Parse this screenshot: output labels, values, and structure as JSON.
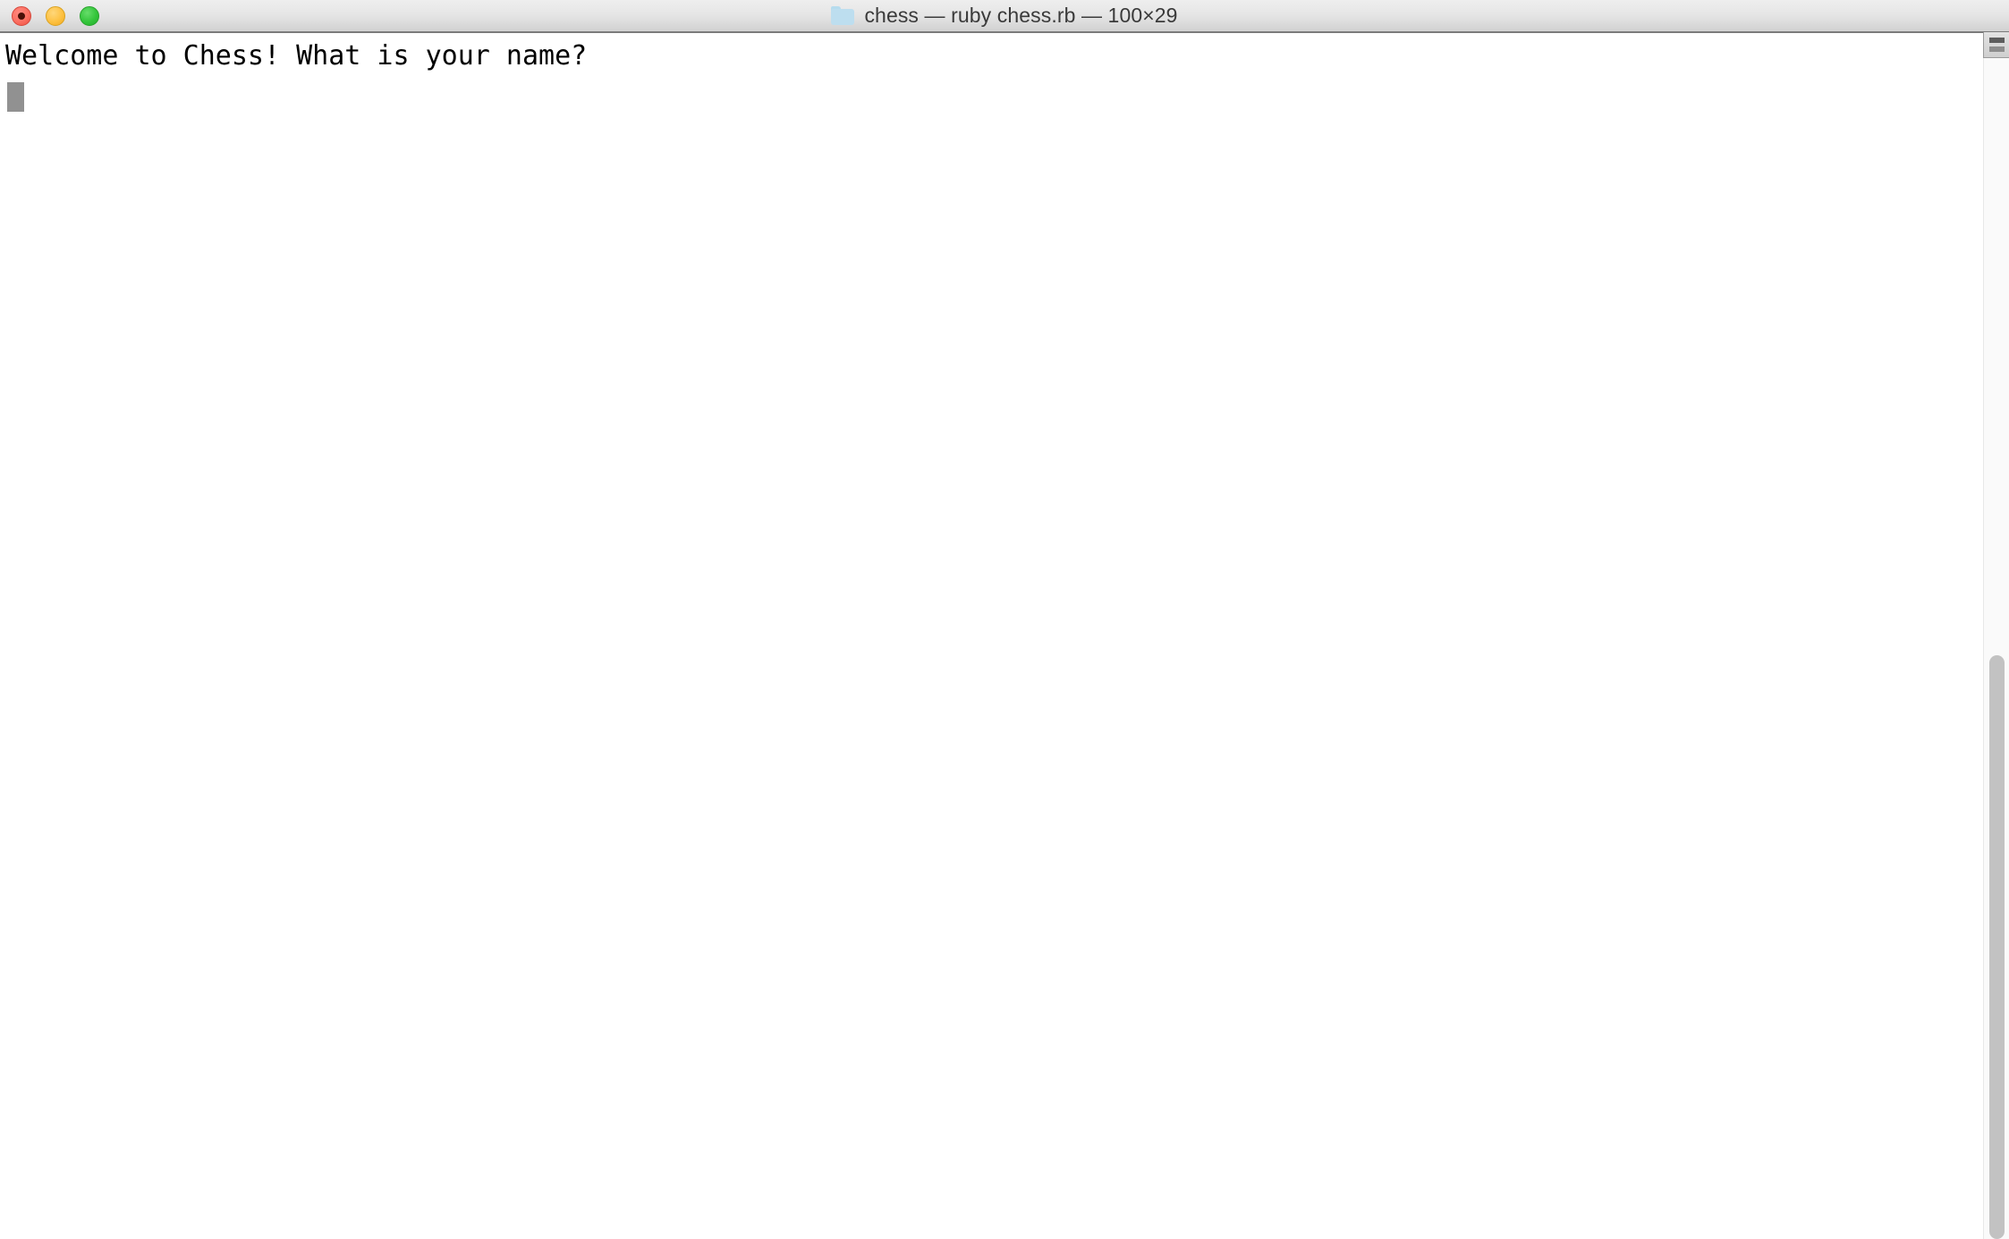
{
  "window": {
    "titlebar": {
      "title": "chess — ruby chess.rb — 100×29",
      "folder_icon": "folder-icon",
      "buttons": {
        "close_label": "",
        "minimize_label": "",
        "zoom_label": ""
      }
    },
    "terminal": {
      "lines": [
        "Welcome to Chess! What is your name?"
      ],
      "cursor": {
        "visible": true,
        "line": 2,
        "column": 1,
        "color": "#919191"
      },
      "columns": 100,
      "rows": 29,
      "foreground": "#000000",
      "background": "#ffffff"
    },
    "scrollbar": {
      "thumb_color": "#c2c2c2",
      "track_color": "#fafafa"
    },
    "split_pane_button": {
      "label": "split-pane"
    }
  }
}
